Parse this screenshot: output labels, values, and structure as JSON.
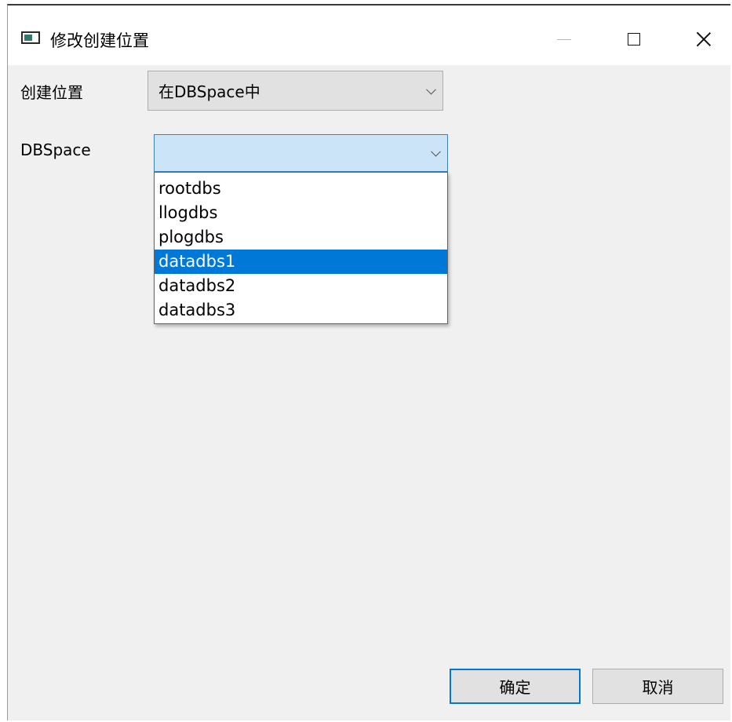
{
  "window": {
    "title": "修改创建位置"
  },
  "form": {
    "location_label": "创建位置",
    "location_value": "在DBSpace中",
    "dbspace_label": "DBSpace",
    "dbspace_value": ""
  },
  "dropdown": {
    "options": [
      "rootdbs",
      "llogdbs",
      "plogdbs",
      "datadbs1",
      "datadbs2",
      "datadbs3"
    ],
    "highlighted": "datadbs1"
  },
  "buttons": {
    "ok_label": "确定",
    "cancel_label": "取消"
  },
  "icons": {
    "app": "window-icon",
    "minimize": "minimize-icon",
    "maximize": "maximize-icon",
    "close": "close-icon",
    "combo_arrow": "chevron-down-icon"
  },
  "colors": {
    "highlight": "#0078d7",
    "focus_bg": "#cce4f7"
  }
}
